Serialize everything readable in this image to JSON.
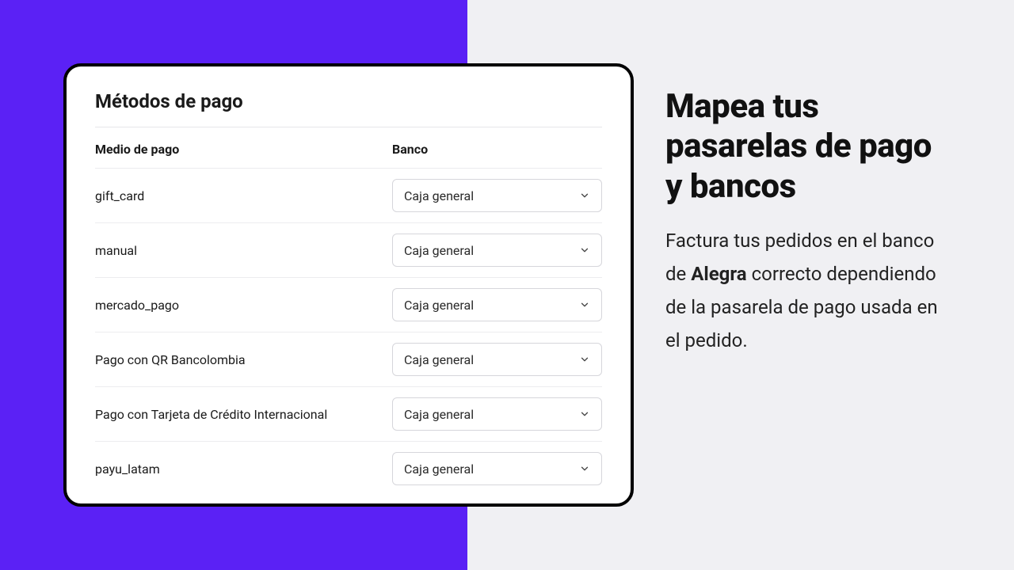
{
  "card": {
    "title": "Métodos de pago",
    "columns": {
      "method": "Medio de pago",
      "bank": "Banco"
    },
    "rows": [
      {
        "method": "gift_card",
        "bank": "Caja general"
      },
      {
        "method": "manual",
        "bank": "Caja general"
      },
      {
        "method": "mercado_pago",
        "bank": "Caja general"
      },
      {
        "method": "Pago con QR Bancolombia",
        "bank": "Caja general"
      },
      {
        "method": "Pago con Tarjeta de Crédito Internacional",
        "bank": "Caja general"
      },
      {
        "method": "payu_latam",
        "bank": "Caja general"
      }
    ]
  },
  "marketing": {
    "headline": "Mapea tus pasarelas de pago y bancos",
    "body_pre": "Factura tus pedidos en el banco de ",
    "body_bold": "Alegra",
    "body_post": " correcto dependiendo de la pasarela de pago usada en el pedido."
  }
}
